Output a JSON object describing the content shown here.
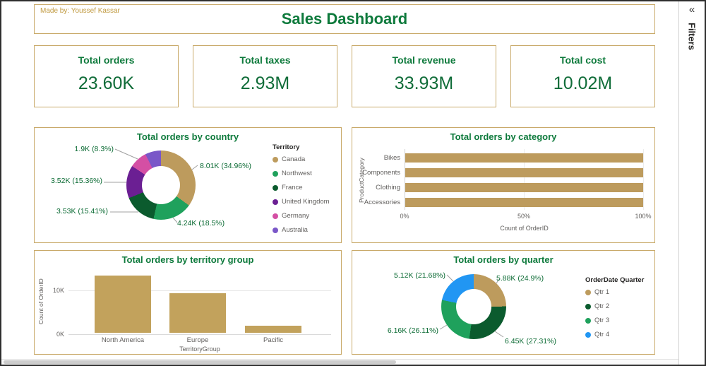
{
  "header": {
    "made_by": "Made by: Youssef Kassar",
    "title": "Sales Dashboard"
  },
  "filters_pane": {
    "label": "Filters",
    "collapse_icon": "«"
  },
  "kpis": [
    {
      "label": "Total orders",
      "value": "23.60K"
    },
    {
      "label": "Total taxes",
      "value": "2.93M"
    },
    {
      "label": "Total revenue",
      "value": "33.93M"
    },
    {
      "label": "Total cost",
      "value": "10.02M"
    }
  ],
  "colors": {
    "accent_green": "#0E7A3C",
    "accent_tan": "#BD9B5D",
    "panel_border": "#C9AA6A",
    "made_by_gold": "#C09A40",
    "label_green": "#0A6A33",
    "axis_gray": "#605E5C"
  },
  "chart_data": [
    {
      "type": "pie",
      "subtype": "donut",
      "title": "Total orders by country",
      "legend_title": "Territory",
      "legend_position": "right",
      "slices": [
        {
          "label": "Canada",
          "value_text": "8.01K (34.96%)",
          "pct": 34.96,
          "color": "#BD9B5D"
        },
        {
          "label": "Northwest",
          "value_text": "4.24K (18.5%)",
          "pct": 18.5,
          "color": "#1FA15C"
        },
        {
          "label": "France",
          "value_text": "3.53K (15.41%)",
          "pct": 15.41,
          "color": "#0B5B2E"
        },
        {
          "label": "United Kingdom",
          "value_text": "3.52K (15.36%)",
          "pct": 15.36,
          "color": "#6B1F93"
        },
        {
          "label": "Germany",
          "value_text": "1.9K (8.3%)",
          "pct": 8.3,
          "color": "#D44FA4"
        },
        {
          "label": "Australia",
          "value_text": "",
          "pct": 7.47,
          "color": "#7A57C8"
        }
      ]
    },
    {
      "type": "bar",
      "orientation": "horizontal",
      "title": "Total orders by category",
      "xlabel": "Count of OrderID",
      "ylabel": "ProductCategory",
      "categories": [
        "Bikes",
        "Components",
        "Clothing",
        "Accessories"
      ],
      "values_pct": [
        100,
        100,
        100,
        100
      ],
      "x_ticks": [
        "0%",
        "50%",
        "100%"
      ],
      "xlim": [
        0,
        100
      ],
      "bar_color": "#BD9B5D",
      "grid": true
    },
    {
      "type": "bar",
      "orientation": "vertical",
      "title": "Total orders by territory group",
      "xlabel": "TerritoryGroup",
      "ylabel": "Count of OrderID",
      "categories": [
        "North America",
        "Europe",
        "Pacific"
      ],
      "values_k": [
        13.0,
        9.0,
        1.6
      ],
      "y_ticks": [
        "0K",
        "10K"
      ],
      "ylim": [
        0,
        14
      ],
      "bar_color": "#C2A25C",
      "grid": true
    },
    {
      "type": "pie",
      "subtype": "donut",
      "title": "Total orders by quarter",
      "legend_title": "OrderDate Quarter",
      "legend_position": "right",
      "slices": [
        {
          "label": "Qtr 1",
          "value_text": "5.88K (24.9%)",
          "pct": 24.9,
          "color": "#BD9B5D"
        },
        {
          "label": "Qtr 2",
          "value_text": "6.45K (27.31%)",
          "pct": 27.31,
          "color": "#0B5B2E"
        },
        {
          "label": "Qtr 3",
          "value_text": "6.16K (26.11%)",
          "pct": 26.11,
          "color": "#1FA15C"
        },
        {
          "label": "Qtr 4",
          "value_text": "5.12K (21.68%)",
          "pct": 21.68,
          "color": "#2196F3"
        }
      ]
    }
  ]
}
